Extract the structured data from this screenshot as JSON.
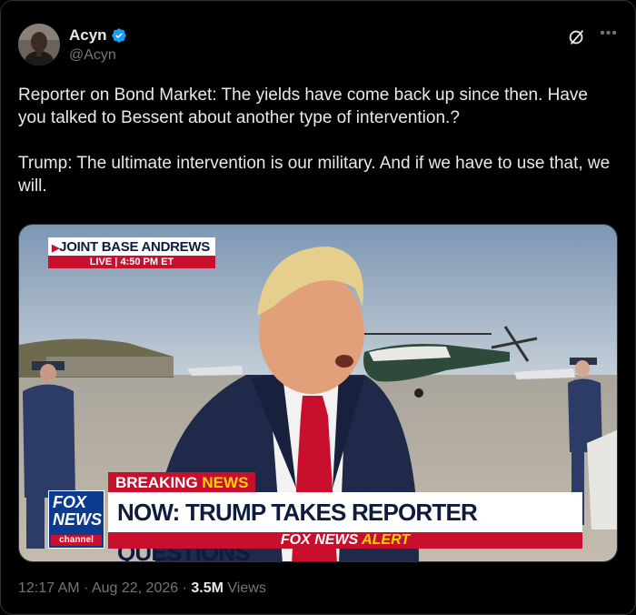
{
  "author": {
    "display_name": "Acyn",
    "handle": "@Acyn"
  },
  "tweet": {
    "text": "Reporter on Bond Market: The yields have come back up since then. Have you talked to Bessent about another type of intervention.?\n\nTrump: The ultimate intervention is our military. And if we have to use that, we will."
  },
  "media": {
    "location": "JOINT BASE ANDREWS",
    "live_label": "LIVE",
    "time_label": "4:50 PM ET",
    "breaking_prefix": "BREAKING",
    "breaking_suffix": "NEWS",
    "headline": "NOW: TRUMP TAKES REPORTER QUESTIONS",
    "alert_prefix": "FOX NEWS",
    "alert_suffix": "ALERT",
    "logo_top": "FOX",
    "logo_bottom": "NEWS",
    "logo_channel": "channel"
  },
  "meta": {
    "time": "12:17 AM",
    "separator": "·",
    "date": "Aug 22, 2026",
    "views_count": "3.5M",
    "views_label": "Views"
  },
  "colors": {
    "background": "#000000",
    "text_primary": "#e7e9ea",
    "text_secondary": "#71767b",
    "verified_blue": "#1d9bf0",
    "fox_red": "#c8102e",
    "fox_blue": "#0b3b8f"
  },
  "icons": {
    "verified": "verified-badge-icon",
    "grok": "grok-icon",
    "more": "more-icon"
  }
}
